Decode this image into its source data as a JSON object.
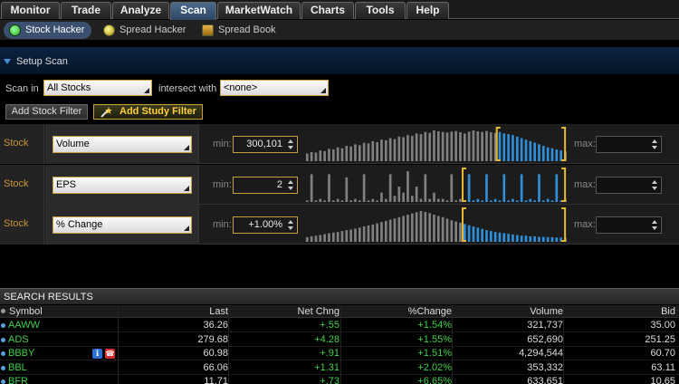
{
  "tabs": [
    "Monitor",
    "Trade",
    "Analyze",
    "Scan",
    "MarketWatch",
    "Charts",
    "Tools",
    "Help"
  ],
  "active_tab": "Scan",
  "subtabs": [
    {
      "label": "Stock Hacker",
      "icon": "stock-hacker-icon"
    },
    {
      "label": "Spread Hacker",
      "icon": "spread-hacker-icon"
    },
    {
      "label": "Spread Book",
      "icon": "spread-book-icon"
    }
  ],
  "setup": {
    "title": "Setup Scan",
    "scan_in_label": "Scan in",
    "scan_in_value": "All Stocks",
    "intersect_label": "intersect with",
    "intersect_value": "<none>",
    "add_stock_filter": "Add Stock Filter",
    "add_study_filter": "Add Study Filter"
  },
  "filters": [
    {
      "type": "Stock",
      "field": "Volume",
      "min_label": "min:",
      "min": "300,101",
      "max_label": "max:",
      "max": "",
      "bars": [
        0.25,
        0.3,
        0.28,
        0.35,
        0.33,
        0.4,
        0.38,
        0.45,
        0.42,
        0.5,
        0.48,
        0.55,
        0.52,
        0.6,
        0.58,
        0.65,
        0.62,
        0.7,
        0.68,
        0.75,
        0.72,
        0.8,
        0.78,
        0.85,
        0.82,
        0.9,
        0.88,
        0.95,
        0.92,
        1.0,
        0.97,
        0.95,
        0.93,
        0.96,
        0.98,
        0.94,
        0.9,
        0.96,
        1.0,
        0.97,
        0.95,
        0.98,
        0.94,
        0.92,
        0.95,
        0.9,
        0.88,
        0.85,
        0.8,
        0.75,
        0.7,
        0.65,
        0.6,
        0.55,
        0.5,
        0.45,
        0.42,
        0.38,
        0.35,
        0.32
      ],
      "sel_start": 0.73,
      "sel_end": 0.99
    },
    {
      "type": "Stock",
      "field": "EPS",
      "min_label": "min:",
      "min": "2",
      "max_label": "max:",
      "max": "",
      "bars": [
        0.05,
        0.9,
        0.05,
        0.1,
        0.05,
        0.9,
        0.05,
        0.1,
        0.05,
        0.8,
        0.05,
        0.1,
        0.05,
        0.9,
        0.05,
        0.1,
        0.05,
        0.3,
        0.1,
        0.9,
        0.2,
        0.5,
        0.3,
        1.0,
        0.2,
        0.5,
        0.1,
        0.9,
        0.1,
        0.3,
        0.1,
        0.1,
        0.05,
        0.9,
        0.05,
        0.1,
        0.05,
        0.9,
        0.05,
        0.1,
        0.05,
        0.9,
        0.05,
        0.1,
        0.05,
        0.9,
        0.05,
        0.1,
        0.05,
        0.9,
        0.05,
        0.1,
        0.05,
        0.9,
        0.05,
        0.1,
        0.05,
        0.9,
        0.05,
        0.1
      ],
      "sel_start": 0.6,
      "sel_end": 0.99
    },
    {
      "type": "Stock",
      "field": "% Change",
      "min_label": "min:",
      "min": "+1.00%",
      "max_label": "max:",
      "max": "",
      "bars": [
        0.15,
        0.18,
        0.2,
        0.22,
        0.25,
        0.28,
        0.3,
        0.32,
        0.35,
        0.38,
        0.4,
        0.43,
        0.46,
        0.5,
        0.53,
        0.56,
        0.6,
        0.64,
        0.68,
        0.72,
        0.76,
        0.8,
        0.84,
        0.88,
        0.92,
        0.96,
        1.0,
        0.97,
        0.93,
        0.88,
        0.84,
        0.8,
        0.75,
        0.7,
        0.66,
        0.62,
        0.58,
        0.54,
        0.5,
        0.46,
        0.42,
        0.38,
        0.35,
        0.32,
        0.3,
        0.28,
        0.26,
        0.24,
        0.22,
        0.2,
        0.2,
        0.18,
        0.18,
        0.16,
        0.16,
        0.15,
        0.15,
        0.14,
        0.14,
        0.13
      ],
      "sel_start": 0.6,
      "sel_end": 0.99
    }
  ],
  "results": {
    "title": "SEARCH RESULTS",
    "columns": [
      "Symbol",
      "Last",
      "Net Chng",
      "%Change",
      "Volume",
      "Bid"
    ],
    "rows": [
      {
        "symbol": "AAWW",
        "last": "36.26",
        "net": "+.55",
        "pct": "+1.54%",
        "volume": "321,737",
        "bid": "35.00",
        "icons": false
      },
      {
        "symbol": "ADS",
        "last": "279.68",
        "net": "+4.28",
        "pct": "+1.55%",
        "volume": "652,690",
        "bid": "251.25",
        "icons": false
      },
      {
        "symbol": "BBBY",
        "last": "60.98",
        "net": "+.91",
        "pct": "+1.51%",
        "volume": "4,294,544",
        "bid": "60.70",
        "icons": true
      },
      {
        "symbol": "BBL",
        "last": "66.06",
        "net": "+1.31",
        "pct": "+2.02%",
        "volume": "353,332",
        "bid": "63.11",
        "icons": false
      },
      {
        "symbol": "BFR",
        "last": "11.71",
        "net": "+.73",
        "pct": "+6.65%",
        "volume": "633,651",
        "bid": "10.65",
        "icons": false
      }
    ]
  },
  "colors": {
    "accent": "#c8a03a",
    "positive": "#3fd14a",
    "histogram": "#808080",
    "histogram_selected": "#2f8fd8"
  }
}
